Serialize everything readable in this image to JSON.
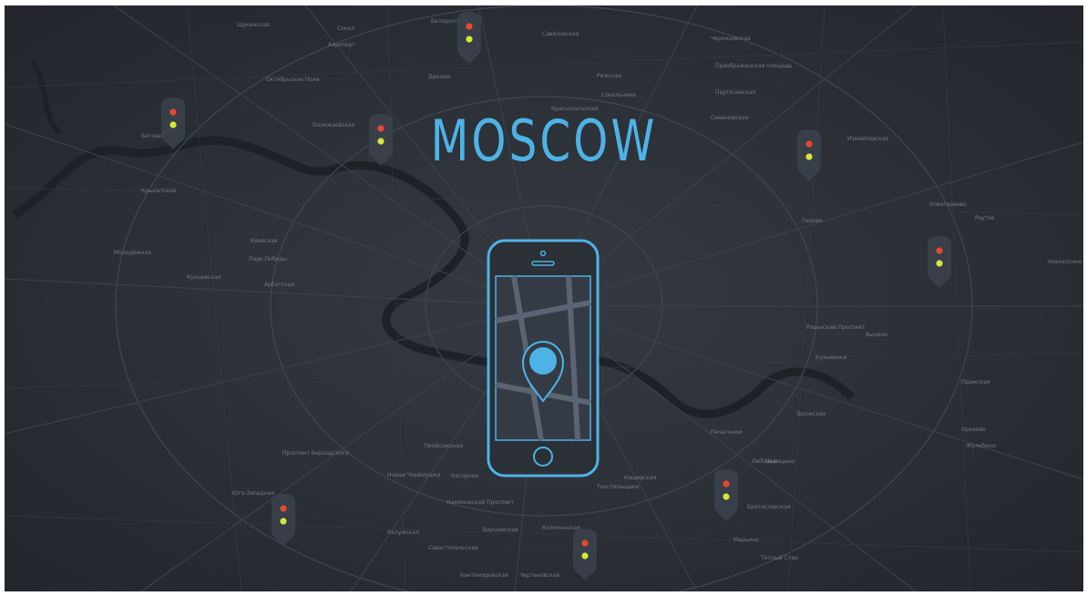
{
  "title": "MOSCOW",
  "colors": {
    "background": "#2b2f36",
    "accent": "#4db3e6",
    "light_red": "#e8482e",
    "light_yellow": "#d6e63a"
  },
  "phone": {
    "icon": "smartphone-icon",
    "screen_icon": "map-pin-icon"
  },
  "markers": [
    {
      "name": "traffic-light-marker-1",
      "icon": "traffic-light-icon"
    },
    {
      "name": "traffic-light-marker-2",
      "icon": "traffic-light-icon"
    },
    {
      "name": "traffic-light-marker-3",
      "icon": "traffic-light-icon"
    },
    {
      "name": "traffic-light-marker-4",
      "icon": "traffic-light-icon"
    },
    {
      "name": "traffic-light-marker-5",
      "icon": "traffic-light-icon"
    },
    {
      "name": "traffic-light-marker-6",
      "icon": "traffic-light-icon"
    },
    {
      "name": "traffic-light-marker-7",
      "icon": "traffic-light-icon"
    },
    {
      "name": "traffic-light-marker-8",
      "icon": "traffic-light-icon"
    }
  ],
  "map_labels": [
    "Щукинская",
    "Сокол",
    "Аэропорт",
    "Динамо",
    "Белорусская",
    "Савёловская",
    "Рижская",
    "Сокольники",
    "Черкизовская",
    "Преображенская площадь",
    "Октябрьское Поле",
    "Полежаевская",
    "Беговая",
    "Красносельская",
    "Семёновская",
    "Измайловская",
    "Партизанская",
    "Крылатское",
    "Молодёжная",
    "Кунцевская",
    "Парк Победы",
    "Киевская",
    "Арбатская",
    "Новогиреево",
    "Перово",
    "Кузьминки",
    "Выхино",
    "Рязанский Проспект",
    "Профсоюзная",
    "Проспект Вернадского",
    "Юго-Западная",
    "Калужская",
    "Новые Черёмушки",
    "Нагорная",
    "Нахимовский Проспект",
    "Варшавская",
    "Севастопольская",
    "Коломенская",
    "Кантемировская",
    "Каширская",
    "Царицыно",
    "Орехово",
    "Марьино",
    "Братиславская",
    "Люблино",
    "Печатники",
    "Текстильщики",
    "Волжская",
    "Жулебино",
    "Новокосино",
    "Реутов",
    "Тёплый Стан",
    "Чертановская",
    "Пражская"
  ]
}
